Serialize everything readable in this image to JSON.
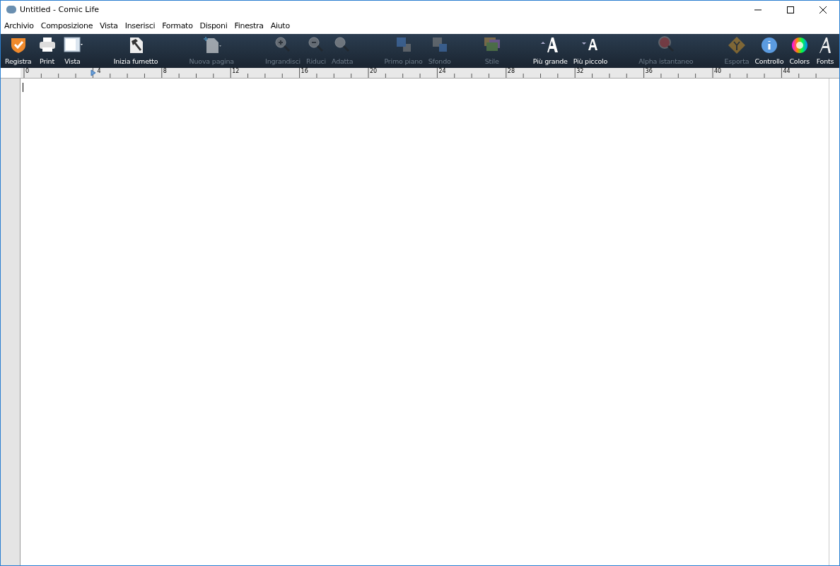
{
  "window": {
    "title": "Untitled - Comic Life"
  },
  "menu": [
    "Archivio",
    "Composizione",
    "Vista",
    "Inserisci",
    "Formato",
    "Disponi",
    "Finestra",
    "Aiuto"
  ],
  "toolbar": {
    "groups": [
      [
        {
          "kind": "registra",
          "label": "Registra",
          "disabled": false
        },
        {
          "kind": "print",
          "label": "Print",
          "disabled": false
        },
        {
          "kind": "vista",
          "label": "Vista",
          "disabled": false
        }
      ],
      [
        {
          "kind": "hammer",
          "label": "Inizia fumetto",
          "disabled": false
        }
      ],
      [
        {
          "kind": "newpage",
          "label": "Nuova pagina",
          "disabled": true
        }
      ],
      [
        {
          "kind": "zoomin",
          "label": "Ingrandisci",
          "disabled": true
        },
        {
          "kind": "zoomout",
          "label": "Riduci",
          "disabled": true
        },
        {
          "kind": "fit",
          "label": "Adatta",
          "disabled": true
        }
      ],
      [
        {
          "kind": "front",
          "label": "Primo piano",
          "disabled": true
        },
        {
          "kind": "back",
          "label": "Sfondo",
          "disabled": true
        }
      ],
      [
        {
          "kind": "style",
          "label": "Stile",
          "disabled": true
        }
      ],
      [
        {
          "kind": "bigger",
          "label": "Più grande",
          "disabled": false
        },
        {
          "kind": "smaller",
          "label": "Più piccolo",
          "disabled": false
        }
      ],
      [
        {
          "kind": "alpha",
          "label": "Alpha istantaneo",
          "disabled": true
        }
      ],
      [
        {
          "kind": "export",
          "label": "Esporta",
          "disabled": true
        },
        {
          "kind": "info",
          "label": "Controllo",
          "disabled": false
        },
        {
          "kind": "colors",
          "label": "Colors",
          "disabled": false
        },
        {
          "kind": "fonts",
          "label": "Fonts",
          "disabled": false
        }
      ]
    ]
  },
  "ruler": {
    "labels": [
      "0",
      "4",
      "8",
      "12",
      "16",
      "20",
      "24",
      "28",
      "32",
      "36",
      "40",
      "44"
    ]
  }
}
